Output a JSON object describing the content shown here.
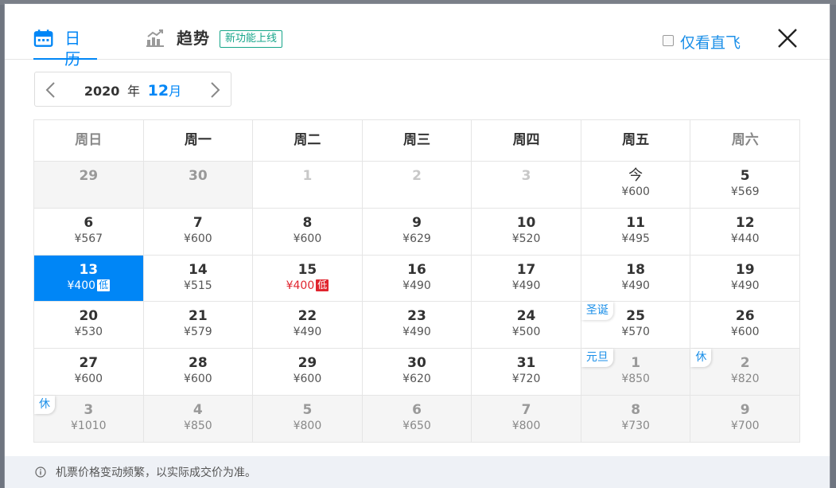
{
  "header": {
    "tab_calendar": "日历",
    "tab_trend": "趋势",
    "new_feature_badge": "新功能上线",
    "direct_only_label": "仅看直飞"
  },
  "month_switch": {
    "year": "2020",
    "year_suffix": "年",
    "month": "12",
    "month_suffix": "月"
  },
  "weekdays": [
    "周日",
    "周一",
    "周二",
    "周三",
    "周四",
    "周五",
    "周六"
  ],
  "days": [
    {
      "num": "29",
      "price": "",
      "state": "past"
    },
    {
      "num": "30",
      "price": "",
      "state": "past"
    },
    {
      "num": "1",
      "price": "",
      "state": "blank"
    },
    {
      "num": "2",
      "price": "",
      "state": "blank"
    },
    {
      "num": "3",
      "price": "",
      "state": "blank"
    },
    {
      "num": "今",
      "price": "¥600",
      "state": "normal",
      "text": true
    },
    {
      "num": "5",
      "price": "¥569",
      "state": "normal"
    },
    {
      "num": "6",
      "price": "¥567",
      "state": "normal"
    },
    {
      "num": "7",
      "price": "¥600",
      "state": "normal"
    },
    {
      "num": "8",
      "price": "¥600",
      "state": "normal"
    },
    {
      "num": "9",
      "price": "¥629",
      "state": "normal"
    },
    {
      "num": "10",
      "price": "¥520",
      "state": "normal"
    },
    {
      "num": "11",
      "price": "¥495",
      "state": "normal"
    },
    {
      "num": "12",
      "price": "¥440",
      "state": "normal"
    },
    {
      "num": "13",
      "price": "¥400",
      "state": "selected",
      "tag": "低"
    },
    {
      "num": "14",
      "price": "¥515",
      "state": "normal"
    },
    {
      "num": "15",
      "price": "¥400",
      "state": "low",
      "tag": "低"
    },
    {
      "num": "16",
      "price": "¥490",
      "state": "normal"
    },
    {
      "num": "17",
      "price": "¥490",
      "state": "normal"
    },
    {
      "num": "18",
      "price": "¥490",
      "state": "normal"
    },
    {
      "num": "19",
      "price": "¥490",
      "state": "normal"
    },
    {
      "num": "20",
      "price": "¥530",
      "state": "normal"
    },
    {
      "num": "21",
      "price": "¥579",
      "state": "normal"
    },
    {
      "num": "22",
      "price": "¥490",
      "state": "normal"
    },
    {
      "num": "23",
      "price": "¥490",
      "state": "normal"
    },
    {
      "num": "24",
      "price": "¥500",
      "state": "normal"
    },
    {
      "num": "25",
      "price": "¥570",
      "state": "normal",
      "holiday": "圣诞"
    },
    {
      "num": "26",
      "price": "¥600",
      "state": "normal"
    },
    {
      "num": "27",
      "price": "¥600",
      "state": "normal"
    },
    {
      "num": "28",
      "price": "¥600",
      "state": "normal"
    },
    {
      "num": "29",
      "price": "¥600",
      "state": "normal"
    },
    {
      "num": "30",
      "price": "¥620",
      "state": "normal"
    },
    {
      "num": "31",
      "price": "¥720",
      "state": "normal"
    },
    {
      "num": "1",
      "price": "¥850",
      "state": "next-month",
      "holiday": "元旦"
    },
    {
      "num": "2",
      "price": "¥820",
      "state": "next-month",
      "holiday": "休"
    },
    {
      "num": "3",
      "price": "¥1010",
      "state": "next-month",
      "holiday": "休"
    },
    {
      "num": "4",
      "price": "¥850",
      "state": "next-month"
    },
    {
      "num": "5",
      "price": "¥800",
      "state": "next-month"
    },
    {
      "num": "6",
      "price": "¥650",
      "state": "next-month"
    },
    {
      "num": "7",
      "price": "¥800",
      "state": "next-month"
    },
    {
      "num": "8",
      "price": "¥730",
      "state": "next-month"
    },
    {
      "num": "9",
      "price": "¥700",
      "state": "next-month"
    }
  ],
  "footer": {
    "note": "机票价格变动频繁，以实际成交价为准。"
  },
  "colors": {
    "accent": "#0086f6",
    "low_price_red": "#e0242e",
    "badge_green": "#16a589"
  },
  "icons": {
    "calendar_tab": "calendar-icon",
    "trend_tab": "trend-chart-icon",
    "close": "close-icon",
    "prev": "chevron-left-icon",
    "next": "chevron-right-icon",
    "info": "info-icon"
  }
}
